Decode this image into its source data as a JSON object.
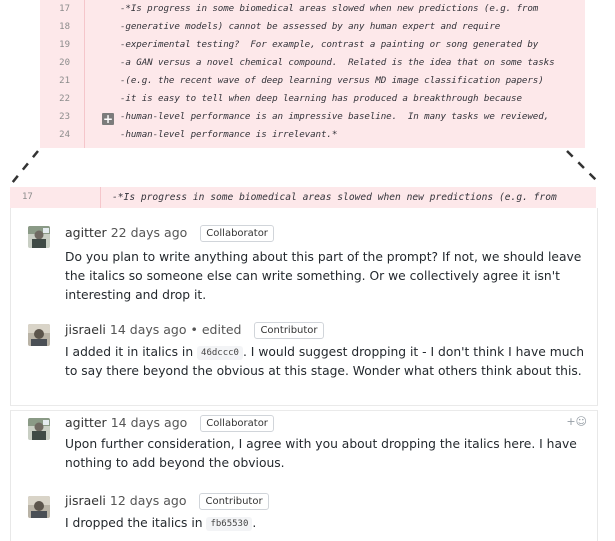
{
  "diff_top": {
    "lines": [
      {
        "num": "17",
        "text": "-*Is progress in some biomedical areas slowed when new predictions (e.g. from"
      },
      {
        "num": "18",
        "text": "-generative models) cannot be assessed by any human expert and require"
      },
      {
        "num": "19",
        "text": "-experimental testing?  For example, contrast a painting or song generated by"
      },
      {
        "num": "20",
        "text": "-a GAN versus a novel chemical compound.  Related is the idea that on some tasks"
      },
      {
        "num": "21",
        "text": "-(e.g. the recent wave of deep learning versus MD image classification papers)"
      },
      {
        "num": "22",
        "text": "-it is easy to tell when deep learning has produced a breakthrough because"
      },
      {
        "num": "23",
        "text": "-human-level performance is an impressive baseline.  In many tasks we reviewed,"
      },
      {
        "num": "24",
        "text": "-human-level performance is irrelevant.*"
      }
    ],
    "expand_label": "+"
  },
  "diff_zoom": {
    "num": "17",
    "text": "-*Is progress in some biomedical areas slowed when new predictions (e.g. from"
  },
  "comments": [
    {
      "author": "agitter",
      "time": "22 days ago",
      "edited": "",
      "badge": "Collaborator",
      "body": "Do you plan to write anything about this part of the prompt? If not, we should leave the italics so someone else can write something. Or we collectively agree it isn't interesting and drop it."
    },
    {
      "author": "jisraeli",
      "time": "14 days ago",
      "edited": "edited",
      "badge": "Contributor",
      "body_pre": "I added it in italics in ",
      "sha": "46dccc0",
      "body_post": ". I would suggest dropping it - I don't think I have much to say there beyond the obvious at this stage. Wonder what others think about this."
    },
    {
      "author": "agitter",
      "time": "14 days ago",
      "edited": "",
      "badge": "Collaborator",
      "body": "Upon further consideration, I agree with you about dropping the italics here. I have nothing to add beyond the obvious."
    },
    {
      "author": "jisraeli",
      "time": "12 days ago",
      "edited": "",
      "badge": "Contributor",
      "body_pre": "I dropped the italics in ",
      "sha": "fb65530",
      "body_post": "."
    }
  ],
  "reaction_icon": "+☺",
  "colors": {
    "diff_deleted_bg": "#fde8ea",
    "gutter_line": "#f5c6cb",
    "badge_border": "#d1d5da"
  }
}
